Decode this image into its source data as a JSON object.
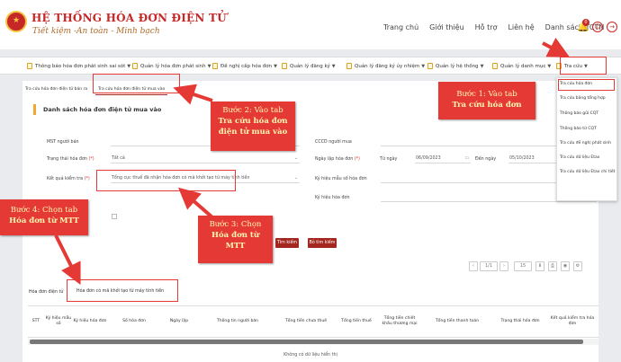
{
  "header": {
    "title": "HỆ THỐNG HÓA ĐƠN ĐIỆN TỬ",
    "slogan": "Tiết kiệm -An toàn - Minh bạch",
    "nav": [
      "Trang chủ",
      "Giới thiệu",
      "Hỗ trợ",
      "Liên hệ",
      "Danh sách TCTN"
    ],
    "notification_count": "0"
  },
  "menu": [
    "Thông báo hóa đơn phát sinh sai sót",
    "Quản lý hóa đơn phát sinh",
    "Đề nghị cấp hóa đơn",
    "Quản lý đăng ký",
    "Quản lý đăng ký ủy nhiệm",
    "Quản lý hệ thống",
    "Quản lý danh mục",
    "Tra cứu"
  ],
  "tabs_top": [
    "Tra cứu hóa đơn điện tử bán ra",
    "Tra cứu hóa đơn điện tử mua vào"
  ],
  "list_title": "Danh sách hóa đơn điện tử mua vào",
  "form": {
    "mst_nguoi_ban": "MST người bán",
    "trang_thai": "Trạng thái hóa đơn",
    "trang_thai_value": "Tất cả",
    "ket_qua": "Kết quả kiểm tra",
    "ket_qua_value": "Tổng cục thuế đã nhận hóa đơn có mã khởi tạo từ máy tính tiền",
    "cccd": "CCCD người mua",
    "ngay_lap": "Ngày lập hóa đơn",
    "tu_ngay": "Từ ngày",
    "tu_ngay_value": "06/09/2023",
    "den_ngay": "Đến ngày",
    "den_ngay_value": "05/10/2023",
    "ky_hieu_mau": "Ký hiệu mẫu số hóa đơn",
    "ky_hieu": "Ký hiệu hóa đơn",
    "required_mark": "(*)"
  },
  "buttons": {
    "search": "Tìm kiếm",
    "advanced": "Bỏ tìm kiếm"
  },
  "pagination": {
    "page": "1/1",
    "size": "15"
  },
  "tabs_bottom": [
    "Hóa đơn điện tử",
    "Hóa đơn có mã khởi tạo từ máy tính tiền"
  ],
  "table_headers": [
    "STT",
    "Ký hiệu mẫu số",
    "Ký hiệu hóa đơn",
    "Số hóa đơn",
    "Ngày lập",
    "Thông tin người bán",
    "Tổng tiền chưa thuế",
    "Tổng tiền thuế",
    "Tổng tiền chiết khấu thương mại",
    "Tổng tiền thanh toán",
    "Trạng thái hóa đơn",
    "Kết quả kiểm tra hóa đơn"
  ],
  "no_data": "Không có dữ liệu hiển thị",
  "dropdown": [
    "Tra cứu hóa đơn",
    "Tra cứu bảng tổng hợp",
    "Thông báo gửi CQT",
    "Thông báo từ CQT",
    "Tra cứu đề nghị phát sinh",
    "Tra cứu dữ liệu Etax",
    "Tra cứu dữ liệu Etax chi tiết"
  ],
  "callouts": {
    "step1_a": "Bước 1: Vào tab",
    "step1_b": "Tra cứu hóa đơn",
    "step2_a": "Bước 2: Vào tab",
    "step2_b": "Tra cứu hóa đơn",
    "step2_c": "điện tử mua vào",
    "step3_a": "Bước 3: Chọn",
    "step3_b": "Hóa đơn từ",
    "step3_c": "MTT",
    "step4_a": "Bước 4: Chọn tab",
    "step4_b": "Hóa đơn từ MTT"
  },
  "colors": {
    "brand_red": "#c62828",
    "callout_red": "#e53935",
    "button_red": "#a3261f",
    "accent_orange": "#f0a830"
  }
}
